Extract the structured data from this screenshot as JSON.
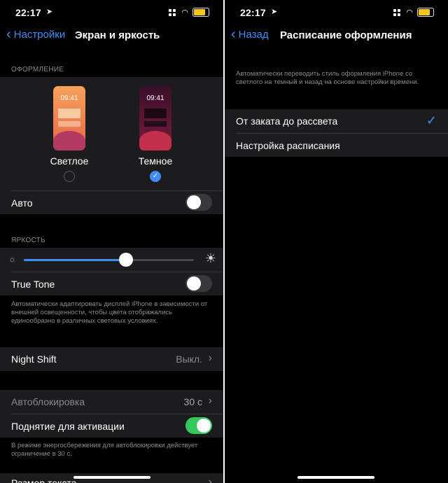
{
  "left": {
    "status": {
      "time": "22:17"
    },
    "nav": {
      "back_label": "Настройки",
      "title": "Экран и яркость"
    },
    "appearance": {
      "header": "ОФОРМЛЕНИЕ",
      "light": {
        "label": "Светлое",
        "preview_time": "09:41",
        "selected": false
      },
      "dark": {
        "label": "Темное",
        "preview_time": "09:41",
        "selected": true
      },
      "auto_label": "Авто",
      "auto_on": false
    },
    "brightness": {
      "header": "ЯРКОСТЬ",
      "level": 0.6,
      "true_tone_label": "True Tone",
      "true_tone_on": false,
      "true_tone_note": "Автоматически адаптировать дисплей iPhone в зависимости от внешней освещенности, чтобы цвета отображались единообразно в различных световых условиях."
    },
    "night_shift": {
      "label": "Night Shift",
      "value": "Выкл."
    },
    "autolock": {
      "label": "Автоблокировка",
      "value": "30 с"
    },
    "raise_to_wake": {
      "label": "Поднятие для активации",
      "on": true
    },
    "power_note": "В режиме энергосбережения для автоблокировки действует ограничение в 30 с.",
    "text_size_label": "Размер текста"
  },
  "right": {
    "status": {
      "time": "22:17"
    },
    "nav": {
      "back_label": "Назад",
      "title": "Расписание оформления"
    },
    "description": "Автоматически переводить стиль оформления iPhone со светлого на темный и назад на основе настройки времени.",
    "options": [
      {
        "label": "От заката до рассвета",
        "selected": true
      },
      {
        "label": "Настройка расписания",
        "selected": false
      }
    ]
  },
  "colors": {
    "accent": "#3e8df5",
    "switch_on": "#34c759",
    "battery": "#f5c518"
  }
}
